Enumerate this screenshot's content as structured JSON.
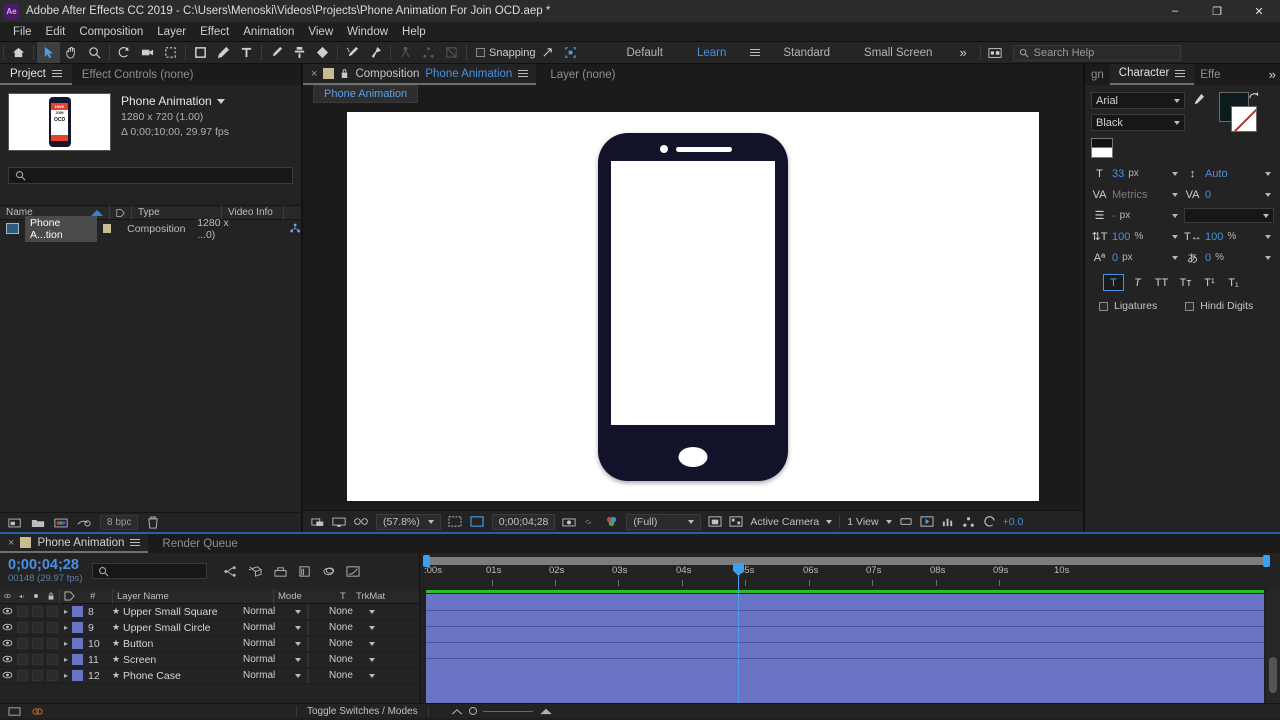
{
  "titlebar": {
    "app_badge": "Ae",
    "title": "Adobe After Effects CC 2019 - C:\\Users\\Menoski\\Videos\\Projects\\Phone Animation For Join OCD.aep *",
    "minimize": "–",
    "maximize": "❐",
    "close": "✕"
  },
  "menu": [
    "File",
    "Edit",
    "Composition",
    "Layer",
    "Effect",
    "Animation",
    "View",
    "Window",
    "Help"
  ],
  "toolbar": {
    "snapping_label": "Snapping",
    "workspaces": [
      "Default",
      "Learn",
      "Standard",
      "Small Screen"
    ],
    "more": "»",
    "search_placeholder": "Search Help"
  },
  "project": {
    "tabs": [
      {
        "label": "Project",
        "active": true
      },
      {
        "label": "Effect Controls (none)",
        "active": false
      }
    ],
    "comp_name": "Phone Animation",
    "comp_dimensions": "1280 x 720 (1.00)",
    "comp_duration": "Δ 0;00;10;00, 29.97 fps",
    "thumbnail": {
      "line1": "HIVE",
      "line2": "JOIN",
      "line3": "OCD"
    },
    "columns": [
      "Name",
      "Type",
      "Video Info"
    ],
    "rows": [
      {
        "name": "Phone A...tion",
        "type": "Composition",
        "video_info": "1280 x ...0)"
      }
    ],
    "footer": {
      "bit_depth": "8 bpc"
    }
  },
  "composition": {
    "tab_prefix": "Composition",
    "tab_name": "Phone Animation",
    "layer_tab": "Layer (none)",
    "breadcrumb": "Phone Animation",
    "footer": {
      "zoom": "(57.8%)",
      "time": "0;00;04;28",
      "resolution": "(Full)",
      "camera": "Active Camera",
      "views": "1 View",
      "exposure": "+0.0"
    }
  },
  "character": {
    "tabs": [
      {
        "label": "gn",
        "active": false
      },
      {
        "label": "Character",
        "active": true
      },
      {
        "label": "Effe",
        "active": false
      }
    ],
    "more": "»",
    "font_family": "Arial",
    "font_style": "Black",
    "font_size": "33",
    "font_size_unit": "px",
    "leading": "Auto",
    "kerning": "Metrics",
    "tracking": "0",
    "stroke_width": "-",
    "stroke_width_unit": "px",
    "vertical_scale": "100",
    "horizontal_scale": "100",
    "percent": "%",
    "baseline_shift": "0",
    "baseline_unit": "px",
    "tsume": "0",
    "tsume_unit": "%",
    "style_buttons": [
      "T",
      "T",
      "TT",
      "Tт",
      "T¹",
      "T₁"
    ],
    "ligatures_label": "Ligatures",
    "hindi_label": "Hindi Digits"
  },
  "timeline": {
    "tabs": [
      {
        "label": "Phone Animation",
        "active": true
      },
      {
        "label": "Render Queue",
        "active": false
      }
    ],
    "current_time": "0;00;04;28",
    "frame_info": "00148 (29.97 fps)",
    "columns": [
      "Layer Name",
      "Mode",
      "T",
      "TrkMat"
    ],
    "hash_col": "#",
    "ruler_ticks": [
      ":00s",
      "01s",
      "02s",
      "03s",
      "04s",
      "05s",
      "06s",
      "07s",
      "08s",
      "09s",
      "10s"
    ],
    "playhead_time_s": 4.93,
    "layers": [
      {
        "index": "8",
        "name": "Upper Small Square",
        "mode": "Normal",
        "trkmat": "None"
      },
      {
        "index": "9",
        "name": "Upper Small Circle",
        "mode": "Normal",
        "trkmat": "None"
      },
      {
        "index": "10",
        "name": "Button",
        "mode": "Normal",
        "trkmat": "None"
      },
      {
        "index": "11",
        "name": "Screen",
        "mode": "Normal",
        "trkmat": "None"
      },
      {
        "index": "12",
        "name": "Phone Case",
        "mode": "Normal",
        "trkmat": "None"
      }
    ],
    "footer": {
      "toggle_label": "Toggle Switches / Modes"
    }
  },
  "colors": {
    "accent_blue": "#4a90e2",
    "layer_bar": "#6a73c4",
    "work_area_green": "#28c228",
    "phone_case": "#12132a"
  }
}
